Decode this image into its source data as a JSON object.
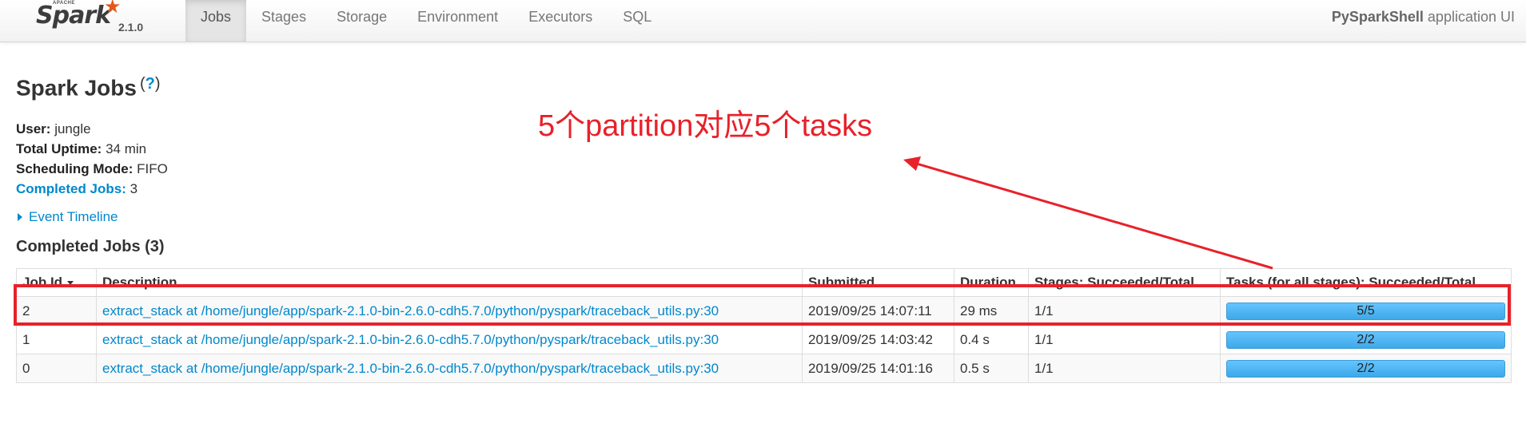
{
  "nav": {
    "brand_apache": "APACHE",
    "brand_name": "Spark",
    "version": "2.1.0",
    "tabs": [
      {
        "label": "Jobs",
        "active": true
      },
      {
        "label": "Stages",
        "active": false
      },
      {
        "label": "Storage",
        "active": false
      },
      {
        "label": "Environment",
        "active": false
      },
      {
        "label": "Executors",
        "active": false
      },
      {
        "label": "SQL",
        "active": false
      }
    ],
    "app_name_bold": "PySparkShell",
    "app_name_suffix": " application UI"
  },
  "page": {
    "title": "Spark Jobs",
    "help_open": "(",
    "help_q": "?",
    "help_close": ")"
  },
  "summary": {
    "user_label": "User:",
    "user_value": " jungle",
    "uptime_label": "Total Uptime:",
    "uptime_value": " 34 min",
    "scheduling_label": "Scheduling Mode:",
    "scheduling_value": " FIFO",
    "completed_label": "Completed Jobs:",
    "completed_value": " 3"
  },
  "event_timeline": "Event Timeline",
  "completed_section_title": "Completed Jobs (3)",
  "table": {
    "headers": [
      "Job Id",
      "Description",
      "Submitted",
      "Duration",
      "Stages: Succeeded/Total",
      "Tasks (for all stages): Succeeded/Total"
    ],
    "rows": [
      {
        "job_id": "2",
        "description": "extract_stack at /home/jungle/app/spark-2.1.0-bin-2.6.0-cdh5.7.0/python/pyspark/traceback_utils.py:30",
        "submitted": "2019/09/25 14:07:11",
        "duration": "29 ms",
        "stages": "1/1",
        "tasks": "5/5",
        "tasks_fraction": 1.0
      },
      {
        "job_id": "1",
        "description": "extract_stack at /home/jungle/app/spark-2.1.0-bin-2.6.0-cdh5.7.0/python/pyspark/traceback_utils.py:30",
        "submitted": "2019/09/25 14:03:42",
        "duration": "0.4 s",
        "stages": "1/1",
        "tasks": "2/2",
        "tasks_fraction": 1.0
      },
      {
        "job_id": "0",
        "description": "extract_stack at /home/jungle/app/spark-2.1.0-bin-2.6.0-cdh5.7.0/python/pyspark/traceback_utils.py:30",
        "submitted": "2019/09/25 14:01:16",
        "duration": "0.5 s",
        "stages": "1/1",
        "tasks": "2/2",
        "tasks_fraction": 1.0
      }
    ]
  },
  "annotation": {
    "text": "5个partition对应5个tasks",
    "color": "#e8212a"
  },
  "colors": {
    "link": "#0088cc",
    "progress_bar": "#3ea8e8"
  }
}
